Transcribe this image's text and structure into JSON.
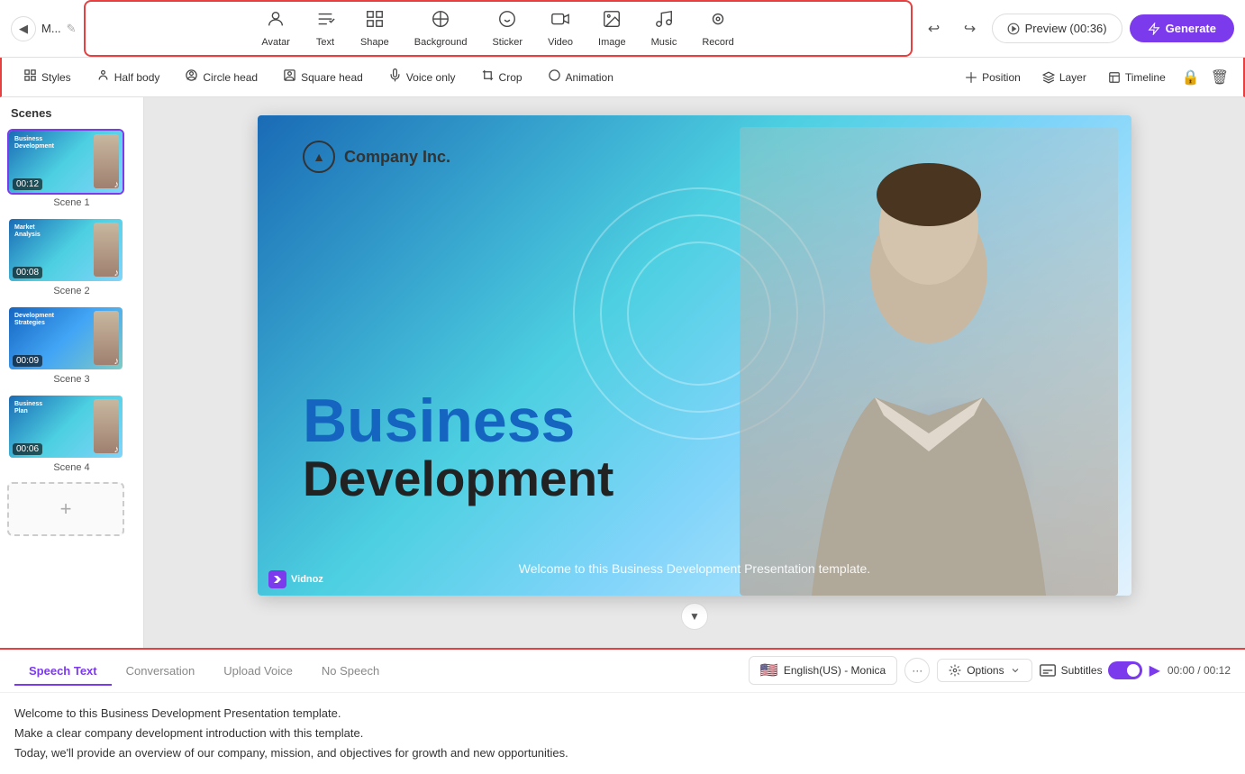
{
  "topbar": {
    "back_icon": "◀",
    "project_name": "M...",
    "edit_icon": "✎",
    "undo_icon": "↩",
    "redo_icon": "↪",
    "preview_label": "Preview (00:36)",
    "generate_label": "Generate",
    "toolbar_items": [
      {
        "id": "avatar",
        "icon": "👤",
        "label": "Avatar"
      },
      {
        "id": "text",
        "icon": "T",
        "label": "Text"
      },
      {
        "id": "shape",
        "icon": "⊞",
        "label": "Shape"
      },
      {
        "id": "background",
        "icon": "⊘",
        "label": "Background"
      },
      {
        "id": "sticker",
        "icon": "☺",
        "label": "Sticker"
      },
      {
        "id": "video",
        "icon": "▶",
        "label": "Video"
      },
      {
        "id": "image",
        "icon": "🖼",
        "label": "Image"
      },
      {
        "id": "music",
        "icon": "♪",
        "label": "Music"
      },
      {
        "id": "record",
        "icon": "⏺",
        "label": "Record"
      }
    ]
  },
  "subtoolbar": {
    "left_items": [
      {
        "id": "styles",
        "icon": "⊞",
        "label": "Styles"
      },
      {
        "id": "half-body",
        "icon": "👤",
        "label": "Half body"
      },
      {
        "id": "circle-head",
        "icon": "👤",
        "label": "Circle head"
      },
      {
        "id": "square-head",
        "icon": "👤",
        "label": "Square head"
      },
      {
        "id": "voice-only",
        "icon": "🔊",
        "label": "Voice only"
      },
      {
        "id": "crop",
        "icon": "⊡",
        "label": "Crop"
      },
      {
        "id": "animation",
        "icon": "○",
        "label": "Animation"
      }
    ],
    "right_items": [
      {
        "id": "position",
        "icon": "✛",
        "label": "Position"
      },
      {
        "id": "layer",
        "icon": "⊕",
        "label": "Layer"
      },
      {
        "id": "timeline",
        "icon": "⊟",
        "label": "Timeline"
      }
    ]
  },
  "scenes": {
    "title": "Scenes",
    "items": [
      {
        "id": 1,
        "label": "Scene 1",
        "duration": "00:12",
        "has_music": true,
        "active": true,
        "text1": "Business",
        "text2": "Development"
      },
      {
        "id": 2,
        "label": "Scene 2",
        "duration": "00:08",
        "has_music": true,
        "text1": "Market",
        "text2": "Analysis"
      },
      {
        "id": 3,
        "label": "Scene 3",
        "duration": "00:09",
        "has_music": true,
        "text1": "Development",
        "text2": "Strategies"
      },
      {
        "id": 4,
        "label": "Scene 4",
        "duration": "00:06",
        "has_music": true,
        "text1": "Business",
        "text2": "Plan"
      }
    ],
    "add_scene_icon": "+"
  },
  "canvas": {
    "company_name": "Company Inc.",
    "title_main": "Business",
    "title_sub": "Development",
    "subtitle": "Welcome to this Business Development Presentation template.",
    "vidnoz_label": "Vidnoz"
  },
  "bottom": {
    "tabs": [
      {
        "id": "speech-text",
        "label": "Speech Text",
        "active": true
      },
      {
        "id": "conversation",
        "label": "Conversation",
        "active": false
      },
      {
        "id": "upload-voice",
        "label": "Upload Voice",
        "active": false
      },
      {
        "id": "no-speech",
        "label": "No Speech",
        "active": false
      }
    ],
    "language": "English(US) - Monica",
    "flag": "🇺🇸",
    "options_label": "Options",
    "subtitles_label": "Subtitles",
    "time_current": "00:00",
    "time_total": "00:12",
    "speech_content": [
      "Welcome to this Business Development Presentation template.",
      "Make a clear company development introduction with this template.",
      "Today, we'll provide an overview of our company, mission, and objectives for growth and new opportunities."
    ]
  }
}
